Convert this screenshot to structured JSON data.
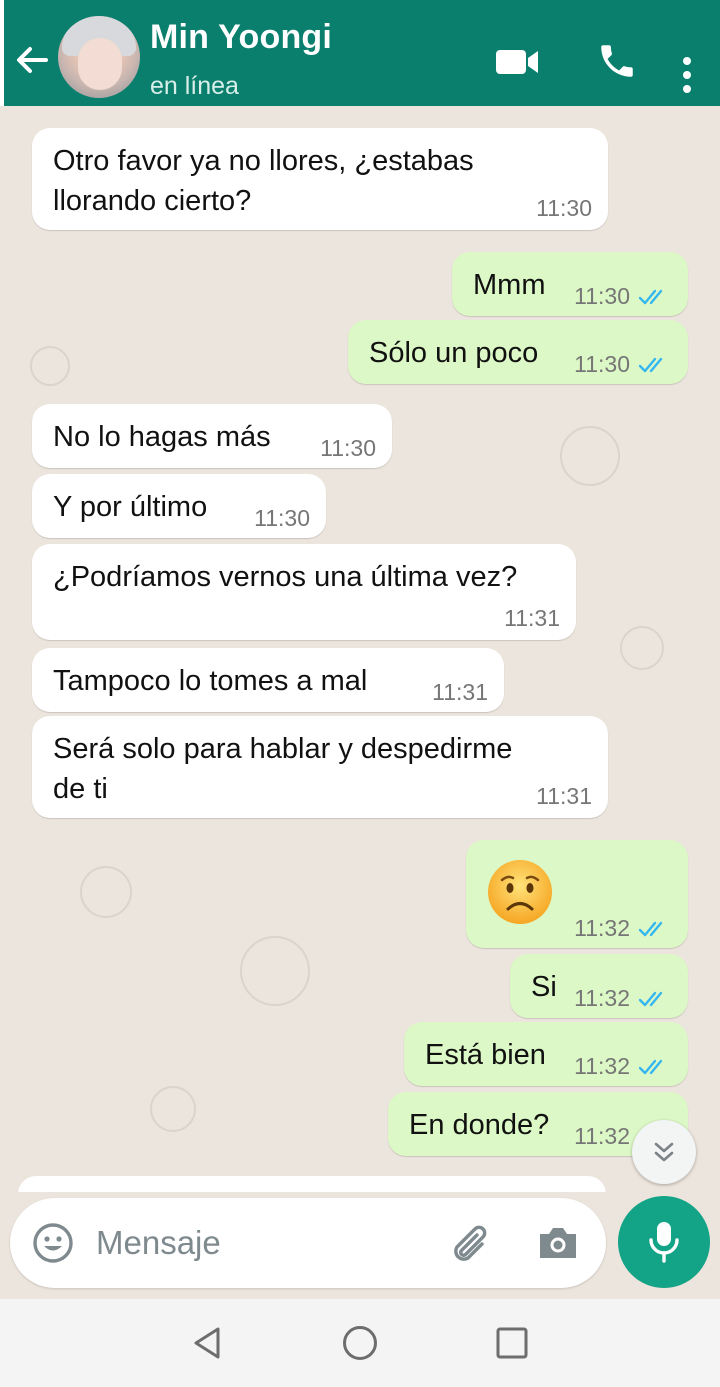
{
  "header": {
    "contact_name": "Min Yoongi",
    "status": "en línea"
  },
  "messages": [
    {
      "dir": "in",
      "lines": [
        "Otro favor ya no llores, ¿estabas",
        "llorando cierto?"
      ],
      "time": "11:30"
    },
    {
      "dir": "out",
      "lines": [
        "Mmm"
      ],
      "time": "11:30",
      "read": true
    },
    {
      "dir": "out",
      "lines": [
        "Sólo un poco"
      ],
      "time": "11:30",
      "read": true
    },
    {
      "dir": "in",
      "lines": [
        "No lo hagas más"
      ],
      "time": "11:30"
    },
    {
      "dir": "in",
      "lines": [
        "Y por último"
      ],
      "time": "11:30"
    },
    {
      "dir": "in",
      "lines": [
        "¿Podríamos vernos una última vez?"
      ],
      "time": "11:31"
    },
    {
      "dir": "in",
      "lines": [
        "Tampoco lo tomes a mal"
      ],
      "time": "11:31"
    },
    {
      "dir": "in",
      "lines": [
        "Será solo para hablar y despedirme",
        "de ti"
      ],
      "time": "11:31"
    },
    {
      "dir": "out",
      "emoji": "worried-face",
      "time": "11:32",
      "read": true
    },
    {
      "dir": "out",
      "lines": [
        "Si"
      ],
      "time": "11:32",
      "read": true
    },
    {
      "dir": "out",
      "lines": [
        "Está bien"
      ],
      "time": "11:32",
      "read": true
    },
    {
      "dir": "out",
      "lines": [
        "En donde?"
      ],
      "time": "11:32",
      "read": true
    }
  ],
  "composer": {
    "placeholder": "Mensaje"
  },
  "colors": {
    "header": "#0a7f6e",
    "outgoing_bubble": "#dcf8c6",
    "incoming_bubble": "#ffffff",
    "read_ticks": "#34b7f1",
    "mic_button": "#13a386"
  }
}
